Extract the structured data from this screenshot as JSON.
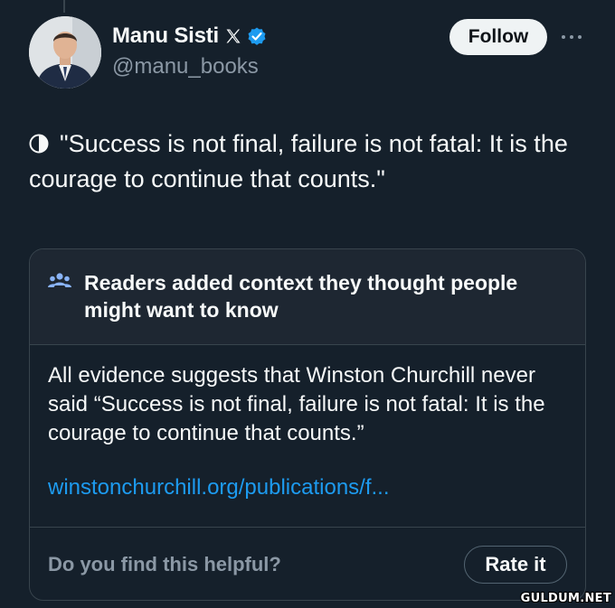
{
  "author": {
    "display_name": "Manu Sisti",
    "handle": "@manu_books",
    "verified": true,
    "platform_badge": "x-logo-icon"
  },
  "actions": {
    "follow_label": "Follow",
    "more_icon": "more-horizontal-icon"
  },
  "tweet": {
    "leading_icon": "half-circle-icon",
    "text": "\"Success is not final, failure is not fatal: It is the courage to continue that counts.\""
  },
  "community_note": {
    "icon": "people-icon",
    "title": "Readers added context they thought people might want to know",
    "body": "All evidence suggests that Winston Churchill never said “Success is not final, failure is not fatal: It is the courage to continue that counts.”",
    "link_text": "winstonchurchill.org/publications/f...",
    "helpful_prompt": "Do you find this helpful?",
    "rate_label": "Rate it"
  },
  "watermark": "GULDUM.NET",
  "colors": {
    "background": "#15202b",
    "note_header_bg": "#1e2732",
    "accent_link": "#1d9bf0",
    "verified_blue": "#1d9bf0",
    "secondary_text": "#8b98a5",
    "primary_text": "#f7f9f9"
  }
}
